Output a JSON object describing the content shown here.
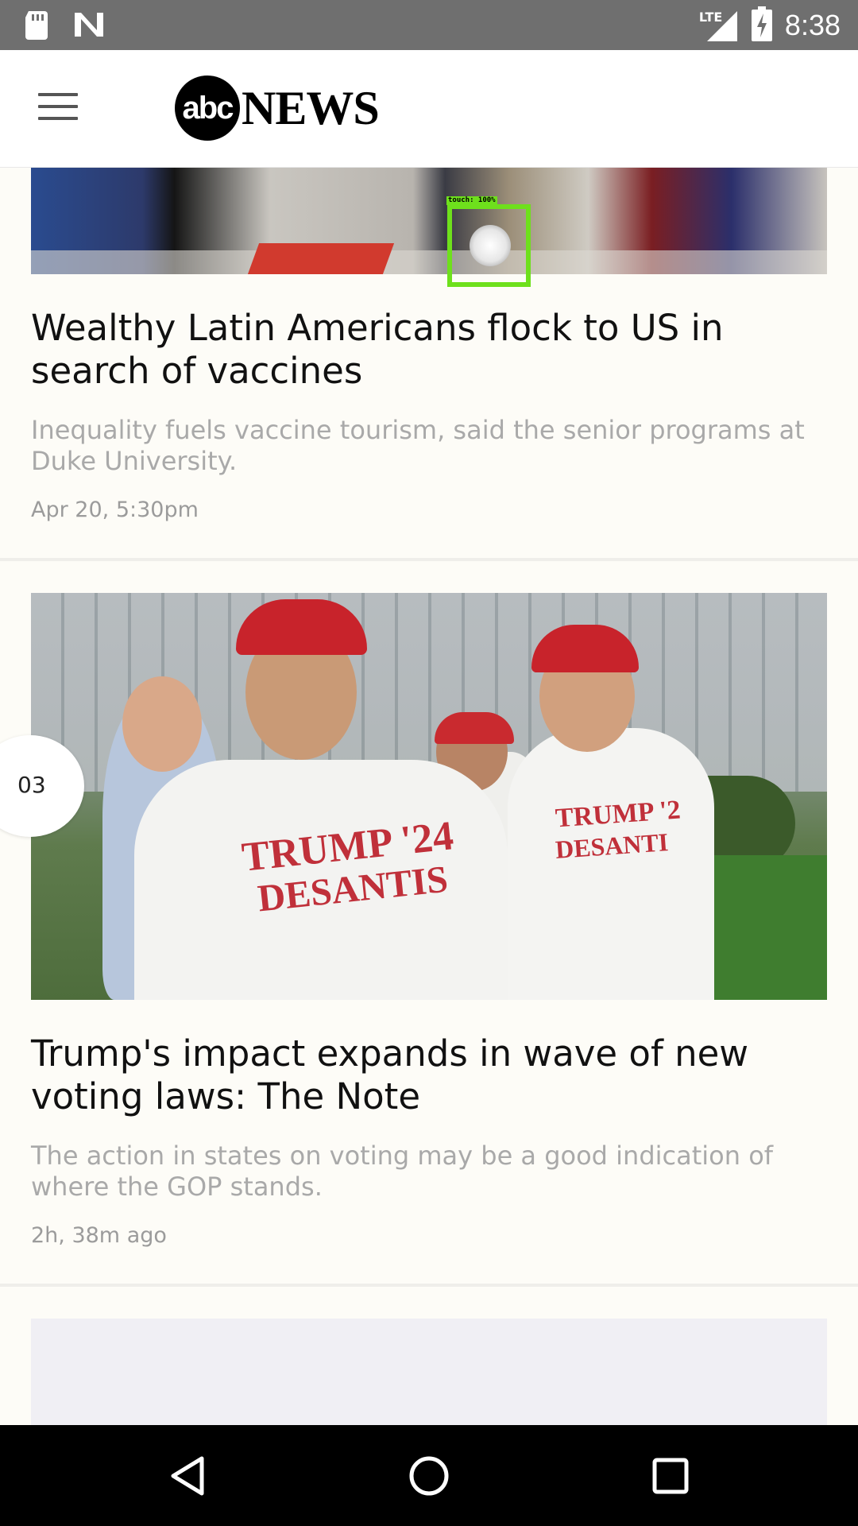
{
  "status_bar": {
    "network_label": "LTE",
    "time": "8:38"
  },
  "header": {
    "logo_abc": "abc",
    "logo_news": "NEWS"
  },
  "overlay": {
    "touch_label": "touch: 100%"
  },
  "articles": [
    {
      "headline": "Wealthy Latin Americans flock to US in search of vaccines",
      "summary": "Inequality fuels vaccine tourism, said the senior programs at Duke University.",
      "timestamp": "Apr 20, 5:30pm"
    },
    {
      "index_badge": "03",
      "headline": "Trump's impact expands in wave of new voting laws: The Note",
      "summary": "The action in states on voting may be a good indication of where the GOP stands.",
      "timestamp": "2h, 38m ago",
      "image_text": [
        "TRUMP '24",
        "DESANTIS",
        "TRUMP '2",
        "DESANTI"
      ]
    }
  ],
  "colors": {
    "status_bar_bg": "#6f6f6f",
    "background": "#fdfcf7",
    "headline": "#111111",
    "summary": "#a9a9a9",
    "touch_highlight": "#6ee01c"
  },
  "icons": {
    "status_left": [
      "sd-card-icon",
      "n-notification-icon"
    ],
    "status_right": [
      "signal-icon",
      "battery-charging-icon"
    ],
    "navigation": [
      "back-icon",
      "home-icon",
      "recents-icon"
    ]
  }
}
